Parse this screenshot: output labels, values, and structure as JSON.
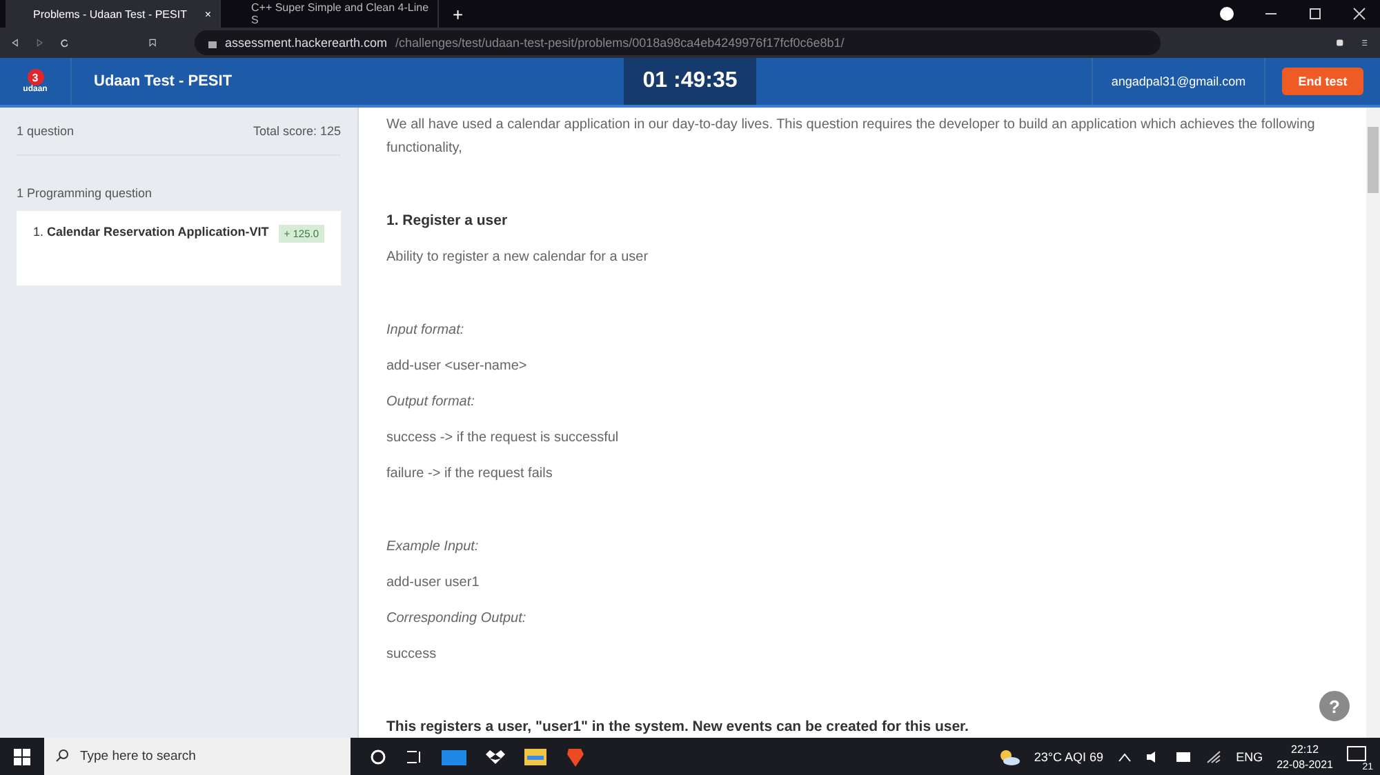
{
  "browser": {
    "tabs": [
      {
        "title": "Problems - Udaan Test - PESIT",
        "selected": true,
        "close": "×"
      },
      {
        "title": "C++ Super Simple and Clean 4-Line S",
        "selected": false
      }
    ],
    "new_tab": "+",
    "url_host": "assessment.hackerearth.com",
    "url_path": "/challenges/test/udaan-test-pesit/problems/0018a98ca4eb4249976f17fcf0c6e8b1/"
  },
  "header": {
    "logo_mark": "3",
    "logo_text": "udaan",
    "title": "Udaan Test - PESIT",
    "timer": "01 :49:35",
    "email": "angadpal31@gmail.com",
    "end_button": "End test"
  },
  "sidebar": {
    "count": "1 question",
    "total": "Total score: 125",
    "section": "1 Programming question",
    "questions": [
      {
        "number": "1.",
        "title": "Calendar Reservation Application-VIT",
        "score": "+ 125.0",
        "selected": true
      }
    ]
  },
  "content": [
    [
      {
        "kind": "text",
        "text": "We all have used a calendar application in our day-to-day lives. This question requires the developer to build an application which achieves the following functionality,"
      }
    ],
    [
      {
        "kind": "heading",
        "text": "1. Register a user"
      },
      {
        "kind": "text",
        "text": "Ability to register a new calendar for a user"
      }
    ],
    [
      {
        "kind": "italic",
        "text": "Input format:"
      },
      {
        "kind": "text",
        "text": "add-user <user-name>"
      },
      {
        "kind": "italic",
        "text": "Output format:"
      },
      {
        "kind": "text",
        "text": "success -> if the request is successful"
      },
      {
        "kind": "text",
        "text": "failure -> if the request fails"
      }
    ],
    [
      {
        "kind": "italic",
        "text": "Example Input:"
      },
      {
        "kind": "text",
        "text": "add-user user1"
      },
      {
        "kind": "italic",
        "text": "Corresponding Output:"
      },
      {
        "kind": "text",
        "text": "success"
      }
    ],
    [
      {
        "kind": "heading",
        "text": "This registers a user, \"user1\" in the system. New events can be created for this user."
      }
    ]
  ],
  "help": "?",
  "taskbar": {
    "search_placeholder": "Type here to search",
    "weather": "23°C  AQI 69",
    "language": "ENG",
    "time": "22:12",
    "date": "22-08-2021",
    "notifications": "21"
  }
}
